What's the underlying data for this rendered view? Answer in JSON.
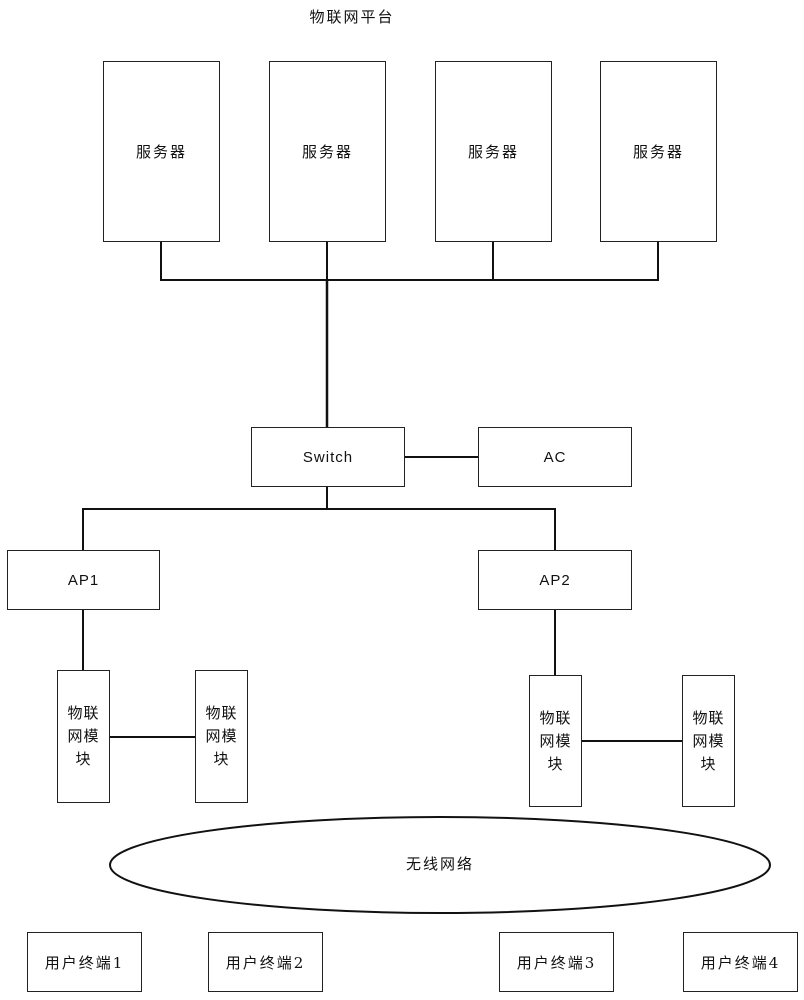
{
  "title": "物联网平台",
  "servers": [
    {
      "label": "服务器"
    },
    {
      "label": "服务器"
    },
    {
      "label": "服务器"
    },
    {
      "label": "服务器"
    }
  ],
  "switch": {
    "label": "Switch"
  },
  "ac": {
    "label": "AC"
  },
  "access_points": [
    {
      "label": "AP1"
    },
    {
      "label": "AP2"
    }
  ],
  "iot_modules": [
    {
      "label": "物联网模块"
    },
    {
      "label": "物联网模块"
    },
    {
      "label": "物联网模块"
    },
    {
      "label": "物联网模块"
    }
  ],
  "wireless_network": {
    "label": "无线网络"
  },
  "user_terminals": [
    {
      "label": "用户终端1"
    },
    {
      "label": "用户终端2"
    },
    {
      "label": "用户终端3"
    },
    {
      "label": "用户终端4"
    }
  ]
}
